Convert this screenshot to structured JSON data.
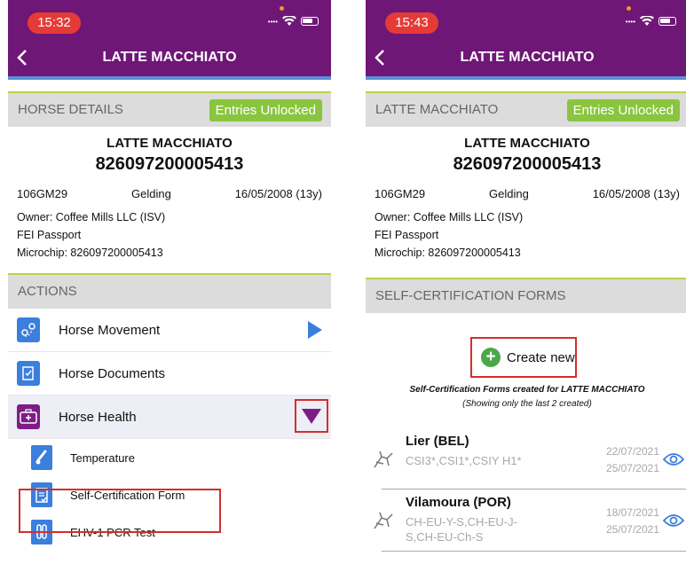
{
  "left": {
    "status_time": "15:32",
    "nav_title": "LATTE MACCHIATO",
    "horse_details_header": "HORSE DETAILS",
    "entries_badge": "Entries Unlocked",
    "horse_name": "LATTE MACCHIATO",
    "passport_number": "826097200005413",
    "id_code": "106GM29",
    "sex": "Gelding",
    "birth": "16/05/2008 (13y)",
    "owner_line": "Owner:  Coffee Mills LLC (ISV)",
    "passport_line": "FEI Passport",
    "microchip_line": "Microchip:  826097200005413",
    "actions_header": "ACTIONS",
    "actions": [
      {
        "label": "Horse Movement",
        "icon": "map-pin-route-icon"
      },
      {
        "label": "Horse Documents",
        "icon": "documents-icon"
      },
      {
        "label": "Horse Health",
        "icon": "medical-kit-icon"
      }
    ],
    "sub_actions": [
      {
        "label": "Temperature",
        "icon": "thermometer-icon"
      },
      {
        "label": "Self-Certification Form",
        "icon": "clipboard-check-icon"
      },
      {
        "label": "EHV-1 PCR Test",
        "icon": "test-tube-icon"
      }
    ]
  },
  "right": {
    "status_time": "15:43",
    "nav_title": "LATTE MACCHIATO",
    "horse_header": "LATTE MACCHIATO",
    "entries_badge": "Entries Unlocked",
    "horse_name": "LATTE MACCHIATO",
    "passport_number": "826097200005413",
    "id_code": "106GM29",
    "sex": "Gelding",
    "birth": "16/05/2008 (13y)",
    "owner_line": "Owner:  Coffee Mills LLC (ISV)",
    "passport_line": "FEI Passport",
    "microchip_line": "Microchip:  826097200005413",
    "forms_header": "SELF-CERTIFICATION FORMS",
    "create_label": "Create new",
    "caption_prefix": "Self-Certification Forms created for ",
    "caption_horse": "LATTE MACCHIATO",
    "caption_note": "(Showing only the last 2 created)",
    "forms": [
      {
        "venue": "Lier  (BEL)",
        "classes": "CSI3*,CSI1*,CSIY H1*",
        "date_from": "22/07/2021",
        "date_to": "25/07/2021"
      },
      {
        "venue": "Vilamoura  (POR)",
        "classes": "CH-EU-Y-S,CH-EU-J-S,CH-EU-Ch-S",
        "date_from": "18/07/2021",
        "date_to": "25/07/2021"
      }
    ]
  },
  "colors": {
    "brand_purple": "#6f1777",
    "accent_green": "#8ac53f",
    "action_blue": "#3b7fdc",
    "highlight_red": "#d42d2d"
  }
}
